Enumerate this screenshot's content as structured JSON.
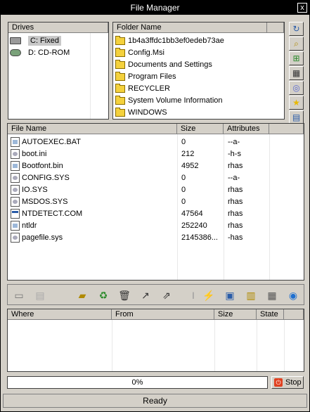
{
  "window": {
    "title": "File Manager",
    "close_label": "x"
  },
  "drives": {
    "header": "Drives",
    "items": [
      {
        "label": "C: Fixed",
        "icon": "hard-drive-icon",
        "selected": true
      },
      {
        "label": "D: CD-ROM",
        "icon": "cdrom-drive-icon",
        "selected": false
      }
    ]
  },
  "folders": {
    "header": "Folder Name",
    "items": [
      "1b4a3ffdc1bb3ef0edeb73ae",
      "Config.Msi",
      "Documents and Settings",
      "Program Files",
      "RECYCLER",
      "System Volume Information",
      "WINDOWS"
    ]
  },
  "files": {
    "headers": {
      "name": "File Name",
      "size": "Size",
      "attributes": "Attributes"
    },
    "rows": [
      {
        "name": "AUTOEXEC.BAT",
        "size": "0",
        "attributes": "--a-",
        "icon": "batch-file-icon"
      },
      {
        "name": "boot.ini",
        "size": "212",
        "attributes": "-h-s",
        "icon": "config-file-icon"
      },
      {
        "name": "Bootfont.bin",
        "size": "4952",
        "attributes": "rhas",
        "icon": "binary-file-icon"
      },
      {
        "name": "CONFIG.SYS",
        "size": "0",
        "attributes": "--a-",
        "icon": "system-file-icon"
      },
      {
        "name": "IO.SYS",
        "size": "0",
        "attributes": "rhas",
        "icon": "system-file-icon"
      },
      {
        "name": "MSDOS.SYS",
        "size": "0",
        "attributes": "rhas",
        "icon": "system-file-icon"
      },
      {
        "name": "NTDETECT.COM",
        "size": "47564",
        "attributes": "rhas",
        "icon": "executable-file-icon"
      },
      {
        "name": "ntldr",
        "size": "252240",
        "attributes": "rhas",
        "icon": "binary-file-icon"
      },
      {
        "name": "pagefile.sys",
        "size": "2145386...",
        "attributes": "-has",
        "icon": "system-file-icon"
      }
    ]
  },
  "transfers": {
    "headers": {
      "where": "Where",
      "from": "From",
      "size": "Size",
      "state": "State"
    }
  },
  "progress": {
    "text": "0%",
    "value": 0
  },
  "stop_label": "Stop",
  "status_text": "Ready"
}
